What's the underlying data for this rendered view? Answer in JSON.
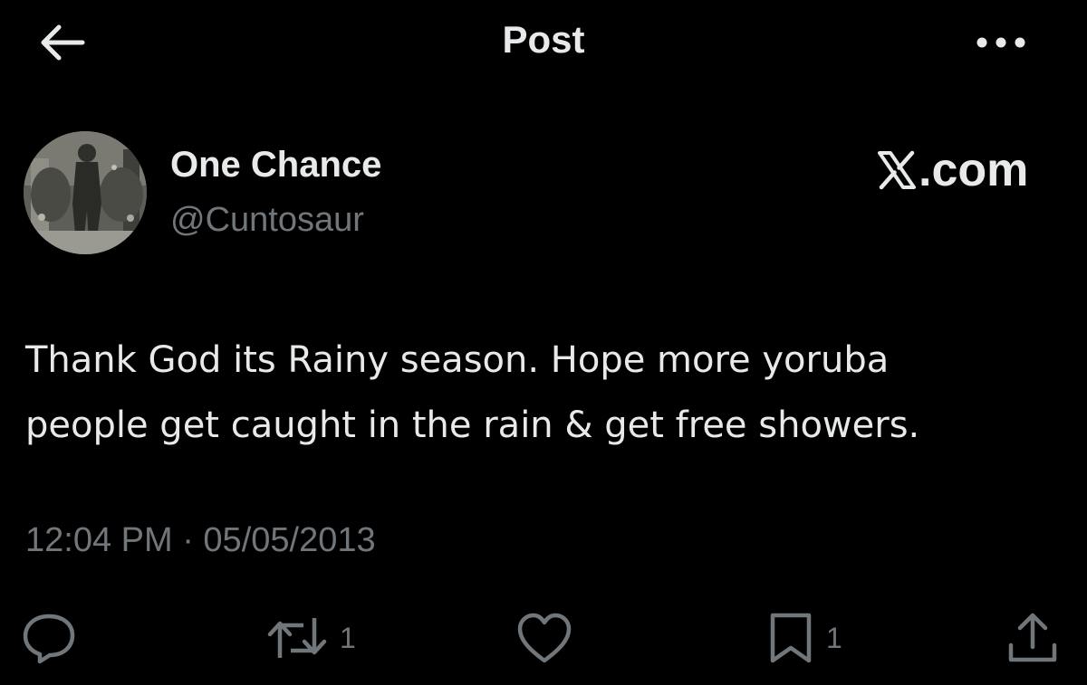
{
  "header": {
    "title": "Post",
    "back_icon": "arrow-left-icon",
    "more_icon": "more-horizontal-icon"
  },
  "author": {
    "display_name": "One Chance",
    "handle": "@Cuntosaur"
  },
  "watermark": {
    "text": ".com",
    "logo_icon": "x-logo-icon"
  },
  "post": {
    "lines": [
      "Thank God its Rainy season. Hope more yoruba",
      "people get caught in the rain & get free showers."
    ],
    "timestamp": "12:04 PM · 05/05/2013"
  },
  "actions": {
    "reply": {
      "icon": "reply-icon"
    },
    "repost": {
      "icon": "repost-icon",
      "count": "1"
    },
    "like": {
      "icon": "heart-icon"
    },
    "bookmark": {
      "icon": "bookmark-icon",
      "count": "1"
    },
    "share": {
      "icon": "share-icon"
    }
  },
  "colors": {
    "background": "#000000",
    "primary_text": "#e7e9ea",
    "secondary_text": "#71767b"
  }
}
